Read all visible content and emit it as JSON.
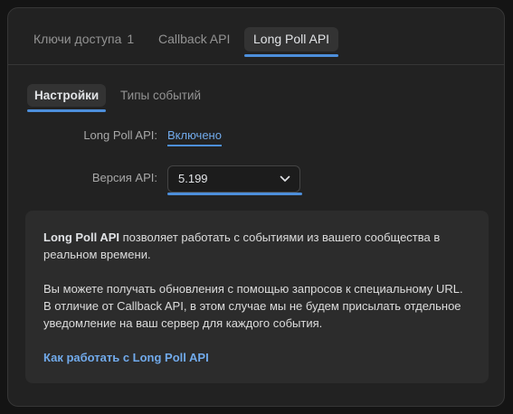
{
  "tabs": {
    "keys_label": "Ключи доступа",
    "keys_count": "1",
    "callback_label": "Callback API",
    "longpoll_label": "Long Poll API"
  },
  "subtabs": {
    "settings_label": "Настройки",
    "events_label": "Типы событий"
  },
  "form": {
    "longpoll_label": "Long Poll API:",
    "longpoll_status": "Включено",
    "version_label": "Версия API:",
    "version_value": "5.199"
  },
  "info": {
    "p1_strong": "Long Poll API",
    "p1_text": " позволяет работать с событиями из вашего сообщества в реальном времени.",
    "p2_text": "Вы можете получать обновления с помощью запросов к специальному URL. В отличие от Callback API, в этом случае мы не будем присылать отдельное уведомление на ваш сервер для каждого события.",
    "link_text": "Как работать с Long Poll API"
  },
  "colors": {
    "accent": "#4d8fdb",
    "link": "#71aaeb",
    "card_bg": "#222222",
    "info_bg": "#2c2c2c"
  },
  "icons": {
    "select_chevron": "chevron-down-icon"
  }
}
